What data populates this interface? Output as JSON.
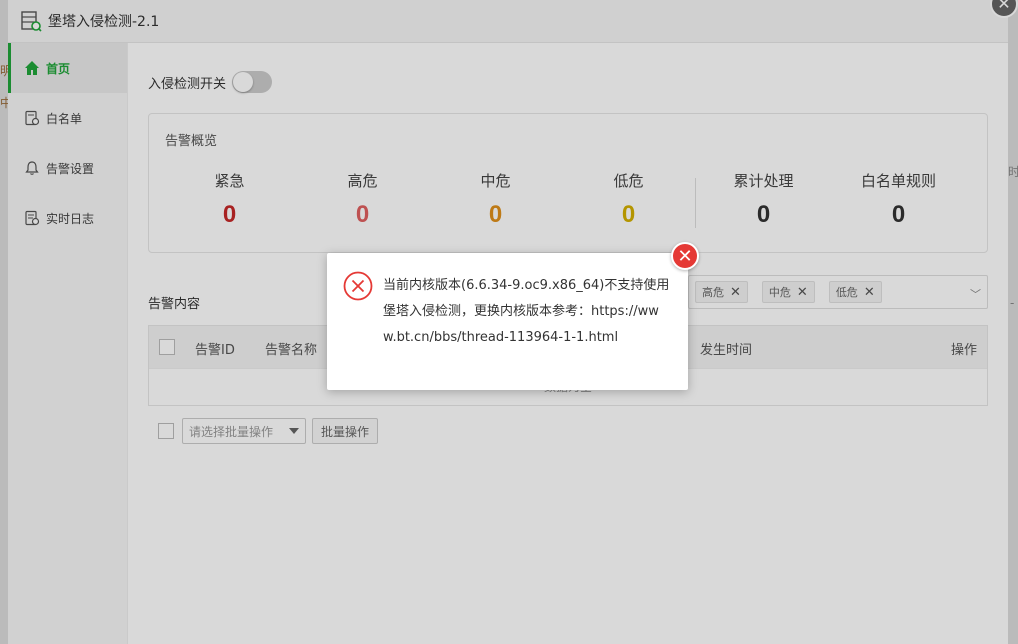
{
  "window": {
    "title": "堡塔入侵检测-2.1"
  },
  "background_fragments": {
    "left_a": "明",
    "left_b": "中",
    "right_a": "时",
    "right_b": "-"
  },
  "sidebar": {
    "items": [
      {
        "label": "首页",
        "icon": "home-icon",
        "active": true
      },
      {
        "label": "白名单",
        "icon": "whitelist-icon",
        "active": false
      },
      {
        "label": "告警设置",
        "icon": "bell-icon",
        "active": false
      },
      {
        "label": "实时日志",
        "icon": "log-icon",
        "active": false
      }
    ]
  },
  "main": {
    "switch_label": "入侵检测开关",
    "overview": {
      "title": "告警概览",
      "stats": [
        {
          "label": "紧急",
          "value": "0",
          "color": "#c62828"
        },
        {
          "label": "高危",
          "value": "0",
          "color": "#e06060"
        },
        {
          "label": "中危",
          "value": "0",
          "color": "#e0901a"
        },
        {
          "label": "低危",
          "value": "0",
          "color": "#d4b000"
        },
        {
          "label": "累计处理",
          "value": "0",
          "color": "#333333"
        },
        {
          "label": "白名单规则",
          "value": "0",
          "color": "#333333"
        }
      ]
    },
    "alerts": {
      "title": "告警内容",
      "filter_tags": [
        "高危",
        "中危",
        "低危"
      ],
      "columns": {
        "id": "告警ID",
        "name": "告警名称",
        "time": "发生时间",
        "action": "操作"
      },
      "empty_text": "数据为空"
    },
    "batch": {
      "select_placeholder": "请选择批量操作",
      "button": "批量操作"
    }
  },
  "dialog": {
    "message": "当前内核版本(6.6.34-9.oc9.x86_64)不支持使用堡塔入侵检测，更换内核版本参考：https://www.bt.cn/bbs/thread-113964-1-1.html"
  },
  "colors": {
    "accent": "#20a53a",
    "error": "#e53935"
  }
}
